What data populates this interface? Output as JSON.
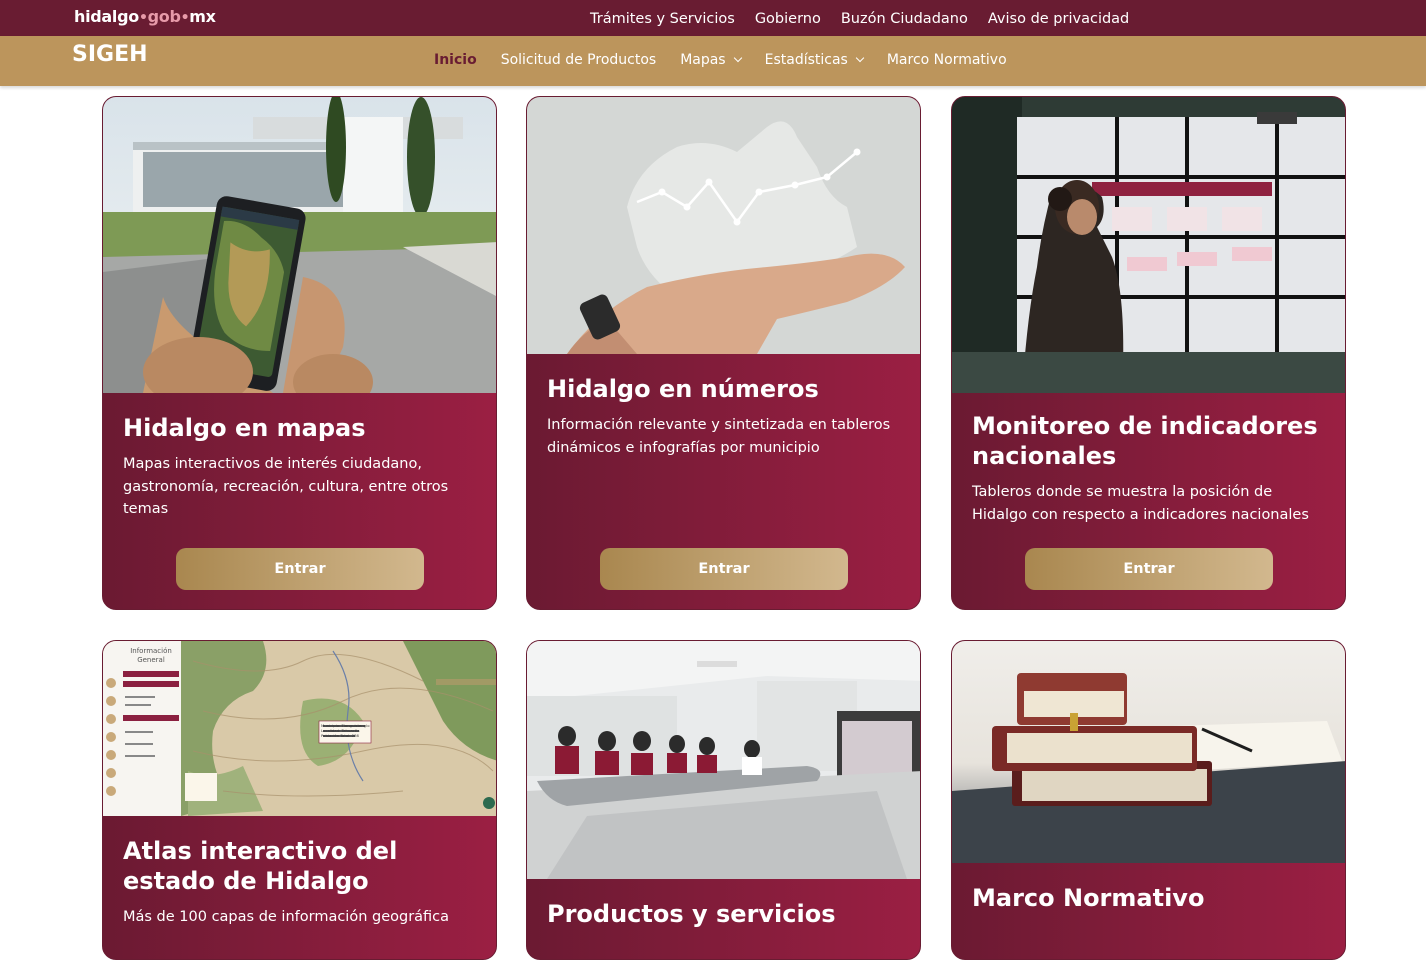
{
  "header": {
    "logo": {
      "part1": "hidalgo",
      "part2": "gob",
      "part3": "mx"
    },
    "top_links": [
      "Trámites y Servicios",
      "Gobierno",
      "Buzón Ciudadano",
      "Aviso de privacidad"
    ],
    "site_title": "SIGEH",
    "nav": [
      {
        "label": "Inicio",
        "active": true
      },
      {
        "label": "Solicitud de Productos"
      },
      {
        "label": "Mapas",
        "dropdown": true
      },
      {
        "label": "Estadísticas",
        "dropdown": true
      },
      {
        "label": "Marco Normativo"
      }
    ]
  },
  "cards": [
    {
      "title": "Hidalgo en mapas",
      "description": "Mapas interactivos de interés ciudadano, gastronomía, recreación, cultura, entre otros temas",
      "button": "Entrar",
      "image": "phone-map-photo"
    },
    {
      "title": "Hidalgo en números",
      "description": "Información relevante y sintetizada en tableros dinámicos e infografías por municipio",
      "button": "Entrar",
      "image": "hand-chart-photo"
    },
    {
      "title": "Monitoreo de indicadores nacionales",
      "description": "Tableros donde se muestra la posición de Hidalgo con respecto a indicadores nacionales",
      "button": "Entrar",
      "image": "dashboard-wall-photo"
    },
    {
      "title": "Atlas interactivo del estado de Hidalgo",
      "description": "Más de 100 capas de información geográfica",
      "image": "atlas-map-screenshot",
      "atlas_ui": {
        "panel_title": "Información General",
        "tooltip_lines": [
          "Municipio: Tlanguistenglo",
          "Localidad: Tehuactla",
          "Población Total: 286"
        ]
      }
    },
    {
      "title": "Productos y servicios",
      "image": "meeting-room-photo"
    },
    {
      "title": "Marco Normativo",
      "image": "books-photo"
    }
  ],
  "colors": {
    "guinda": "#691c32",
    "gold": "#bc955c",
    "card_end": "#9b1f43"
  }
}
